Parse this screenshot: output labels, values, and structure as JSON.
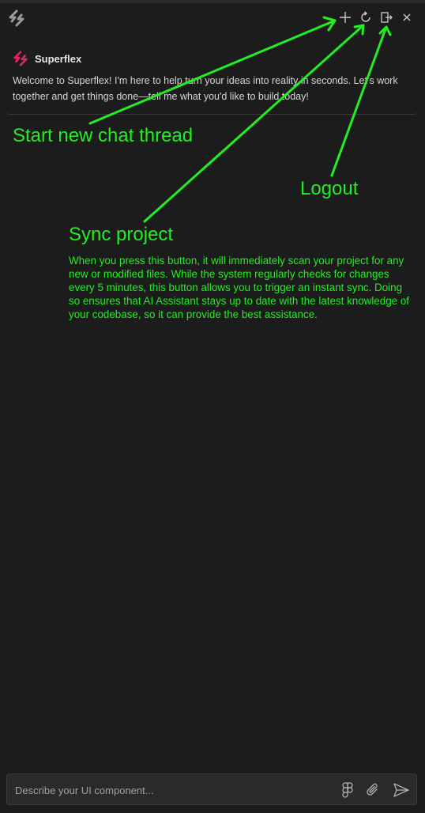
{
  "app": {
    "name": "Superflex"
  },
  "toolbar": {
    "logo_icon": "superflex-logo-icon",
    "buttons": [
      {
        "name": "new-chat",
        "icon": "plus-icon"
      },
      {
        "name": "sync",
        "icon": "refresh-icon"
      },
      {
        "name": "logout",
        "icon": "logout-icon"
      },
      {
        "name": "close",
        "icon": "close-icon"
      }
    ]
  },
  "chat": {
    "messages": [
      {
        "sender": "Superflex",
        "text": "Welcome to Superflex! I'm here to help turn your ideas into reality in seconds. Let’s work together and get things done—tell me what you'd like to build today!"
      }
    ]
  },
  "annotations": {
    "new_chat": "Start new chat thread",
    "logout": "Logout",
    "sync_title": "Sync project",
    "sync_description": "When you press this button, it will immediately scan your project for any new or modified files. While the system regularly checks for changes every 5 minutes, this button allows you to trigger an instant sync. Doing so ensures that AI Assistant stays up to date with the latest knowledge of your codebase, so it can provide the best assistance.",
    "color": "#22ee22"
  },
  "composer": {
    "placeholder": "Describe your UI component...",
    "value": "",
    "buttons": [
      "figma-icon",
      "paperclip-icon",
      "send-icon"
    ]
  },
  "colors": {
    "background": "#1c1c1c",
    "brand": "#e0245e"
  }
}
